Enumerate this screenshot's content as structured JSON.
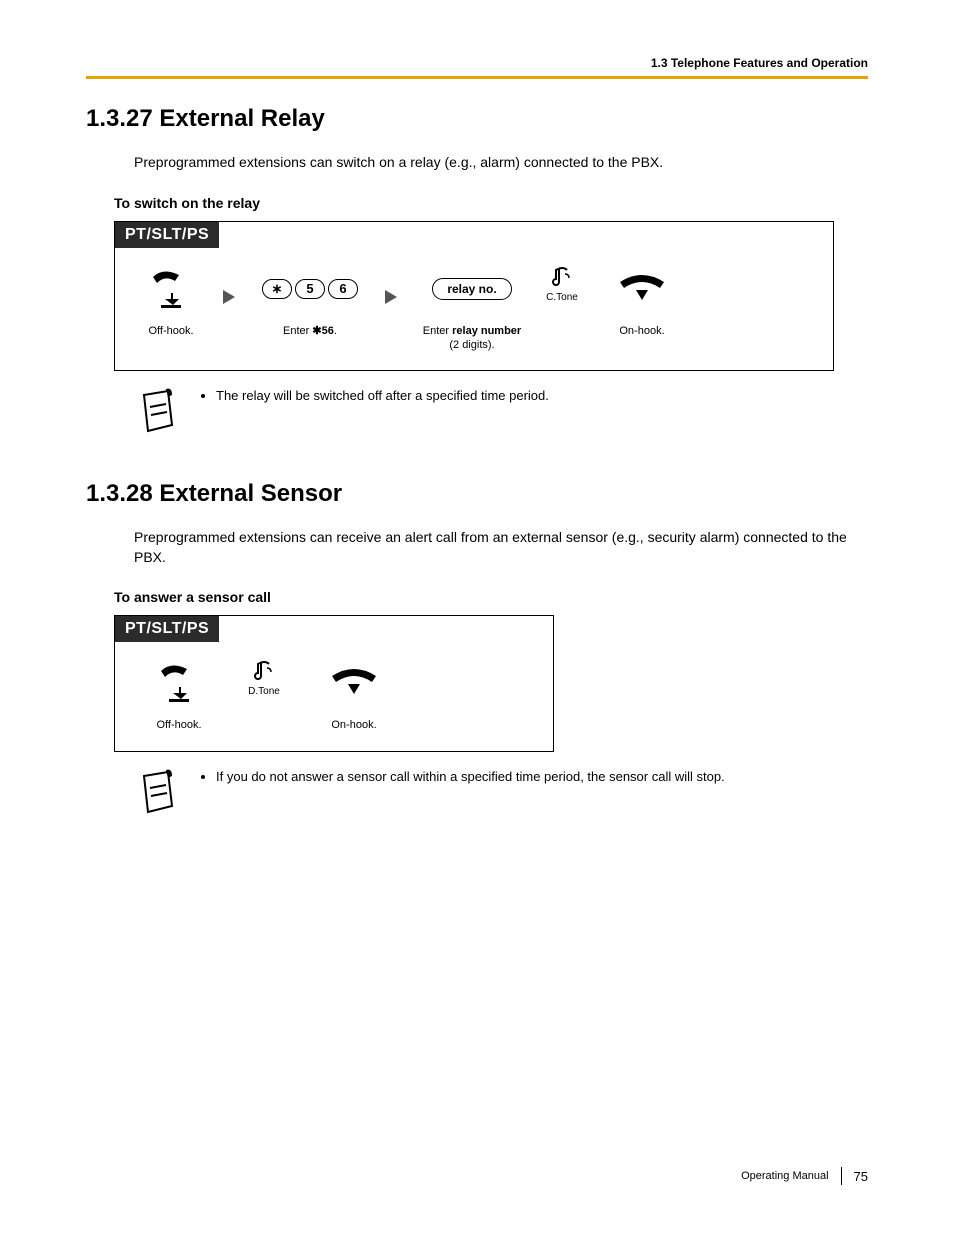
{
  "header": {
    "section": "1.3 Telephone Features and Operation"
  },
  "sec1": {
    "title": "1.3.27  External Relay",
    "body": "Preprogrammed extensions can switch on a relay (e.g., alarm) connected to the PBX.",
    "subhead": "To switch on the relay",
    "tag": "PT/SLT/PS",
    "step_offhook": "Off-hook.",
    "key_star": "∗",
    "key_5": "5",
    "key_6": "6",
    "step_enter56_a": "Enter ",
    "step_enter56_b": "56",
    "step_enter56_c": ".",
    "pill_relay": "relay no.",
    "step_relay_a": "Enter ",
    "step_relay_b": "relay number",
    "step_relay_c": "(2 digits).",
    "tone": "C.Tone",
    "step_onhook": "On-hook.",
    "note": "The relay will be switched off after a specified time period."
  },
  "sec2": {
    "title": "1.3.28  External Sensor",
    "body": "Preprogrammed extensions can receive an alert call from an external sensor (e.g., security alarm) connected to the PBX.",
    "subhead": "To answer a sensor call",
    "tag": "PT/SLT/PS",
    "step_offhook": "Off-hook.",
    "tone": "D.Tone",
    "step_onhook": "On-hook.",
    "note": "If you do not answer a sensor call within a specified time period, the sensor call will stop."
  },
  "footer": {
    "label": "Operating Manual",
    "page": "75"
  }
}
